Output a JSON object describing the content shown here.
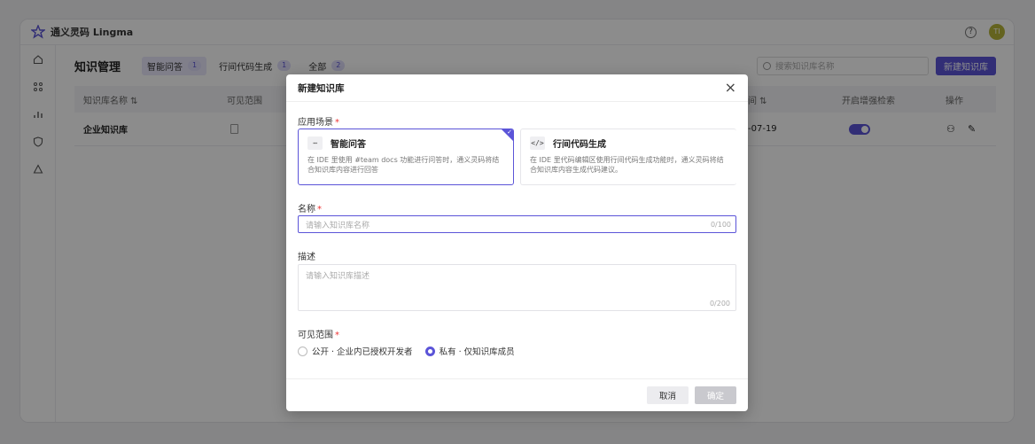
{
  "app": {
    "brand": "通义灵码 Lingma",
    "avatar_text": "TI",
    "help": "?"
  },
  "page": {
    "title": "知识管理",
    "tabs": [
      {
        "label": "智能问答",
        "count": "1"
      },
      {
        "label": "行间代码生成",
        "count": "1"
      },
      {
        "label": "全部",
        "count": "2"
      }
    ],
    "search_placeholder": "搜索知识库名称",
    "new_button": "新建知识库"
  },
  "table": {
    "headers": [
      "知识库名称 ⇅",
      "可见范围",
      "间 ⇅",
      "开启增强检索",
      "操作"
    ],
    "rows": [
      {
        "name": "企业知识库",
        "date": "-07-19"
      }
    ]
  },
  "modal": {
    "title": "新建知识库",
    "close": "×",
    "scene_label": "应用场景",
    "required_mark": "*",
    "cards": [
      {
        "icon": "⋯",
        "title": "智能问答",
        "desc": "在 IDE 里使用 #team docs 功能进行问答时，通义灵码将结合知识库内容进行回答",
        "selected": true
      },
      {
        "icon": "</>",
        "title": "行间代码生成",
        "desc": "在 IDE 里代码编辑区使用行间代码生成功能时，通义灵码将结合知识库内容生成代码建议。",
        "selected": false
      }
    ],
    "name_label": "名称",
    "name_placeholder": "请输入知识库名称",
    "name_counter": "0/100",
    "desc_label": "描述",
    "desc_placeholder": "请输入知识库描述",
    "desc_counter": "0/200",
    "visibility_label": "可见范围",
    "visibility_options": [
      {
        "label": "公开 · 企业内已授权开发者",
        "selected": false
      },
      {
        "label": "私有 · 仅知识库成员",
        "selected": true
      }
    ],
    "cancel_button": "取消",
    "ok_button": "确定"
  },
  "colors": {
    "accent": "#5b54d8"
  }
}
